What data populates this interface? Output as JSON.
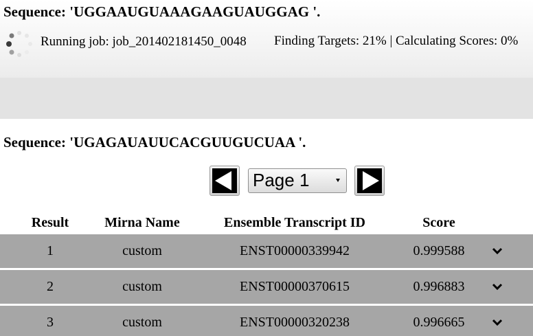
{
  "job_panel": {
    "sequence_title": "Sequence: 'UGGAAUGUAAAGAAGUAUGGAG '.",
    "job_label": "Running job: job_201402181450_0048",
    "progress": "Finding Targets: 21% | Calculating Scores: 0%",
    "spinner_icon": "loading-spinner-icon"
  },
  "results_panel": {
    "sequence_title": "Sequence: 'UGAGAUAUUCACGUUGUCUAA '.",
    "pager": {
      "prev_icon": "arrow-left-icon",
      "next_icon": "arrow-right-icon",
      "selected_page": "Page 1"
    },
    "columns": [
      "Result",
      "Mirna Name",
      "Ensemble Transcript ID",
      "Score"
    ],
    "rows": [
      {
        "result": "1",
        "mirna": "custom",
        "transcript": "ENST00000339942",
        "score": "0.999588"
      },
      {
        "result": "2",
        "mirna": "custom",
        "transcript": "ENST00000370615",
        "score": "0.996883"
      },
      {
        "result": "3",
        "mirna": "custom",
        "transcript": "ENST00000320238",
        "score": "0.996665"
      }
    ],
    "expand_icon": "chevron-down-icon"
  },
  "colors": {
    "row_background": "#a6a6a6",
    "band_background": "#e3e3e3"
  }
}
